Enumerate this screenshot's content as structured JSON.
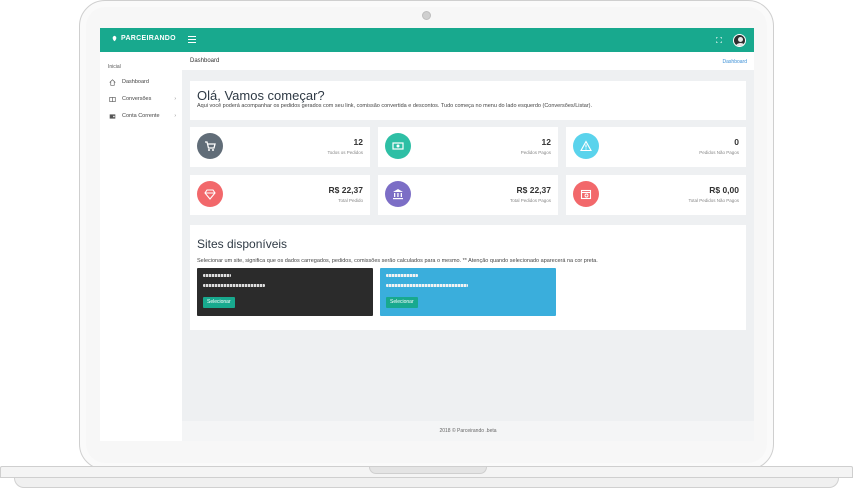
{
  "topbar": {
    "brand": "PARCEIRANDO",
    "accent_color": "#18a98e"
  },
  "sidebar": {
    "caption": "Inicial",
    "items": [
      {
        "label": "Dashboard",
        "icon": "home-icon"
      },
      {
        "label": "Conversões",
        "icon": "card-icon"
      },
      {
        "label": "Conta Corrente",
        "icon": "wallet-icon"
      }
    ]
  },
  "breadcrumb": {
    "title": "Dashboard",
    "link": "Dashboard"
  },
  "welcome": {
    "title": "Olá, Vamos começar?",
    "subtitle": "Aqui você poderá acompanhar os pedidos gerados com seu link, comissão convertida e descontos. Tudo começa no menu do lado esquerdo (Conversões/Listar)."
  },
  "stats": [
    {
      "value": "12",
      "label": "Todos os Pedidos",
      "icon": "cart-icon",
      "color": "#616d78"
    },
    {
      "value": "12",
      "label": "Pedidos Pagos",
      "icon": "money-icon",
      "color": "#2ebfa5"
    },
    {
      "value": "0",
      "label": "Pedidos Não Pagos",
      "icon": "warning-icon",
      "color": "#5ad3ec"
    },
    {
      "value": "R$ 22,37",
      "label": "Total Pedido",
      "icon": "diamond-icon",
      "color": "#f2686b"
    },
    {
      "value": "R$ 22,37",
      "label": "Total Pedidos Pagos",
      "icon": "bank-icon",
      "color": "#7c6ec6"
    },
    {
      "value": "R$ 0,00",
      "label": "Total Pedidos Não Pagos",
      "icon": "calendar-icon",
      "color": "#f2686b"
    }
  ],
  "sites": {
    "title": "Sites disponíveis",
    "subtitle": "Selecionar um site, significa que os dados carregados, pedidos, comissões serão calculados para o mesmo. ** Atenção quando selecionado aparecerá na cor preta.",
    "cards": [
      {
        "button": "Selecionar",
        "color": "#2b2b2b",
        "selected": true
      },
      {
        "button": "Selecionar",
        "color": "#3aaedc",
        "selected": false
      }
    ]
  },
  "footer": {
    "text": "2018 © Parceirando .beta"
  }
}
